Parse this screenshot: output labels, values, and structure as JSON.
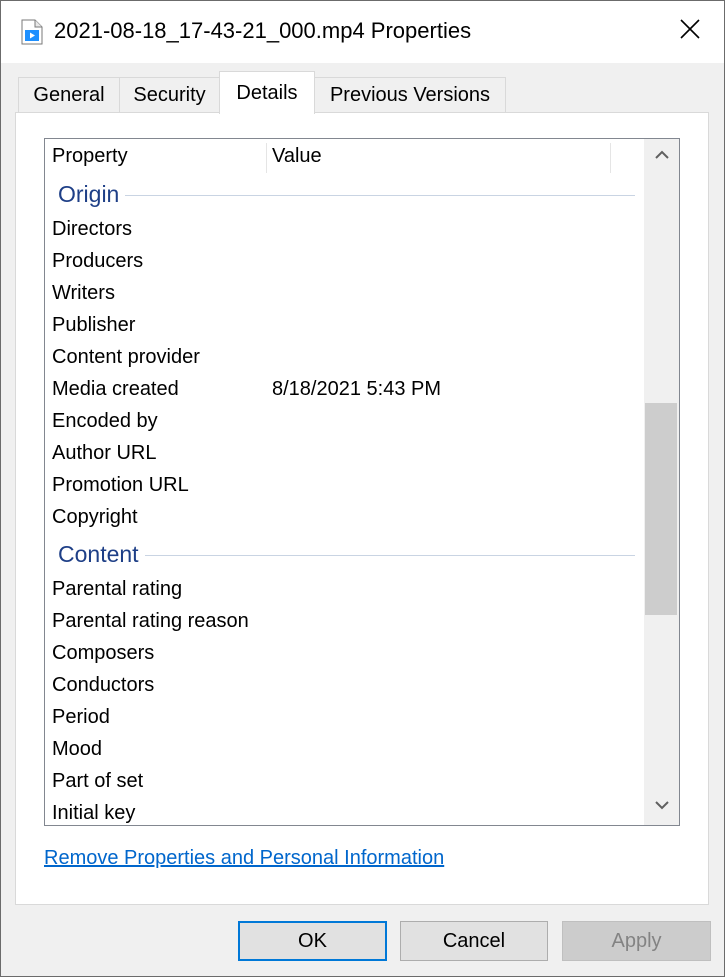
{
  "window": {
    "title": "2021-08-18_17-43-21_000.mp4 Properties"
  },
  "tabs": [
    {
      "label": "General"
    },
    {
      "label": "Security"
    },
    {
      "label": "Details"
    },
    {
      "label": "Previous Versions"
    }
  ],
  "active_tab": "Details",
  "list": {
    "headers": {
      "property": "Property",
      "value": "Value"
    },
    "groups": {
      "origin": {
        "title": "Origin",
        "rows": [
          {
            "property": "Directors",
            "value": ""
          },
          {
            "property": "Producers",
            "value": ""
          },
          {
            "property": "Writers",
            "value": ""
          },
          {
            "property": "Publisher",
            "value": ""
          },
          {
            "property": "Content provider",
            "value": ""
          },
          {
            "property": "Media created",
            "value": "8/18/2021 5:43 PM"
          },
          {
            "property": "Encoded by",
            "value": ""
          },
          {
            "property": "Author URL",
            "value": ""
          },
          {
            "property": "Promotion URL",
            "value": ""
          },
          {
            "property": "Copyright",
            "value": ""
          }
        ]
      },
      "content": {
        "title": "Content",
        "rows": [
          {
            "property": "Parental rating",
            "value": ""
          },
          {
            "property": "Parental rating reason",
            "value": ""
          },
          {
            "property": "Composers",
            "value": ""
          },
          {
            "property": "Conductors",
            "value": ""
          },
          {
            "property": "Period",
            "value": ""
          },
          {
            "property": "Mood",
            "value": ""
          },
          {
            "property": "Part of set",
            "value": ""
          },
          {
            "property": "Initial key",
            "value": ""
          }
        ]
      }
    }
  },
  "link_text": "Remove Properties and Personal Information",
  "buttons": {
    "ok": "OK",
    "cancel": "Cancel",
    "apply": "Apply"
  },
  "icons": {
    "title": "video-file-icon",
    "close": "close-icon",
    "scroll_up": "chevron-up-icon",
    "scroll_down": "chevron-down-icon"
  },
  "colors": {
    "group_title": "#1e3f87",
    "link": "#0066cc",
    "ok_border": "#0078d7"
  }
}
